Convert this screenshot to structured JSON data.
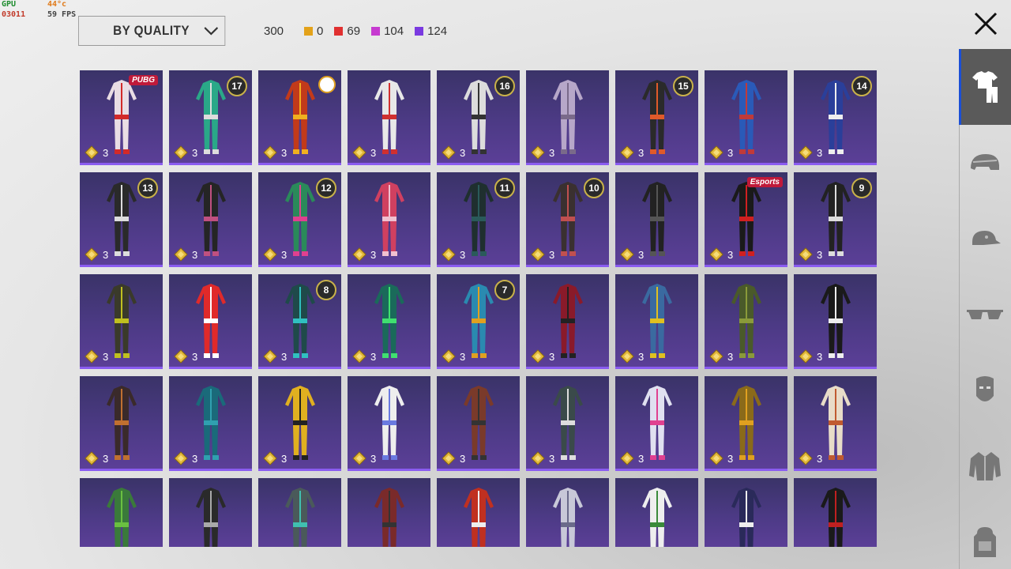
{
  "hud": {
    "gpu_label": "GPU",
    "gpu_value": "03011",
    "temp": "44°c",
    "fps": "59 FPS"
  },
  "sort": {
    "label": "BY QUALITY"
  },
  "stats": {
    "total": "300",
    "items": [
      {
        "value": "0",
        "color": "#e3a21a"
      },
      {
        "value": "69",
        "color": "#e03030"
      },
      {
        "value": "104",
        "color": "#c63ad0"
      },
      {
        "value": "124",
        "color": "#7a3ae0"
      }
    ]
  },
  "rail": [
    "shirt-icon",
    "helmet-icon",
    "cap-icon",
    "glasses-icon",
    "mask-icon",
    "jacket-icon",
    "backpack-icon"
  ],
  "accent": "#1b4fd6",
  "items": [
    {
      "qty": "3",
      "badge": "",
      "tag": "PUBG",
      "color": "#e9dde4",
      "accent": "#d22a2a"
    },
    {
      "qty": "3",
      "badge": "17",
      "tag": "",
      "color": "#2aa888",
      "accent": "#ddd"
    },
    {
      "qty": "3",
      "badge": "",
      "tag": "",
      "crest": true,
      "color": "#c23a1a",
      "accent": "#f0b020"
    },
    {
      "qty": "3",
      "badge": "",
      "tag": "",
      "color": "#e8e8e8",
      "accent": "#d03030"
    },
    {
      "qty": "3",
      "badge": "16",
      "tag": "",
      "color": "#dcdcdc",
      "accent": "#333"
    },
    {
      "qty": "3",
      "badge": "",
      "tag": "",
      "color": "#b7a7c9",
      "accent": "#7a6a8a"
    },
    {
      "qty": "3",
      "badge": "15",
      "tag": "",
      "color": "#2a2a2a",
      "accent": "#e05a2a"
    },
    {
      "qty": "3",
      "badge": "",
      "tag": "",
      "color": "#2a5ab8",
      "accent": "#c03a3a"
    },
    {
      "qty": "3",
      "badge": "14",
      "tag": "",
      "color": "#2a3f9a",
      "accent": "#eee"
    },
    {
      "qty": "3",
      "badge": "13",
      "tag": "",
      "color": "#2a2a2a",
      "accent": "#ddd"
    },
    {
      "qty": "3",
      "badge": "",
      "tag": "",
      "color": "#252525",
      "accent": "#c05080"
    },
    {
      "qty": "3",
      "badge": "12",
      "tag": "",
      "color": "#2a8a5a",
      "accent": "#e04090"
    },
    {
      "qty": "3",
      "badge": "",
      "tag": "",
      "color": "#d04060",
      "accent": "#f0c0d0"
    },
    {
      "qty": "3",
      "badge": "11",
      "tag": "",
      "color": "#1f2f2f",
      "accent": "#2a5a5a"
    },
    {
      "qty": "3",
      "badge": "10",
      "tag": "",
      "color": "#3a3030",
      "accent": "#c05050"
    },
    {
      "qty": "3",
      "badge": "",
      "tag": "",
      "color": "#222",
      "accent": "#555"
    },
    {
      "qty": "3",
      "badge": "",
      "tag": "Esports",
      "color": "#1a1a1a",
      "accent": "#d02020"
    },
    {
      "qty": "3",
      "badge": "9",
      "tag": "",
      "color": "#222",
      "accent": "#ddd"
    },
    {
      "qty": "3",
      "badge": "",
      "tag": "",
      "color": "#3a3a2a",
      "accent": "#c0c020"
    },
    {
      "qty": "3",
      "badge": "",
      "tag": "",
      "color": "#e02a2a",
      "accent": "#fff"
    },
    {
      "qty": "3",
      "badge": "8",
      "tag": "",
      "color": "#1f4a4a",
      "accent": "#30c0c0"
    },
    {
      "qty": "3",
      "badge": "",
      "tag": "",
      "color": "#1a6a5a",
      "accent": "#40e070"
    },
    {
      "qty": "3",
      "badge": "7",
      "tag": "",
      "color": "#2a8ab0",
      "accent": "#e0a020"
    },
    {
      "qty": "3",
      "badge": "",
      "tag": "",
      "color": "#8a1a2a",
      "accent": "#222"
    },
    {
      "qty": "3",
      "badge": "",
      "tag": "",
      "color": "#3a6aa0",
      "accent": "#e0c020"
    },
    {
      "qty": "3",
      "badge": "",
      "tag": "",
      "color": "#4a5a2a",
      "accent": "#8a9a3a"
    },
    {
      "qty": "3",
      "badge": "",
      "tag": "",
      "color": "#1a1a1a",
      "accent": "#eee"
    },
    {
      "qty": "3",
      "badge": "",
      "tag": "",
      "color": "#3a2a2a",
      "accent": "#c07030"
    },
    {
      "qty": "3",
      "badge": "",
      "tag": "",
      "color": "#1a6a7a",
      "accent": "#30a0b0"
    },
    {
      "qty": "3",
      "badge": "",
      "tag": "",
      "color": "#e0b020",
      "accent": "#222"
    },
    {
      "qty": "3",
      "badge": "",
      "tag": "",
      "color": "#eeeeee",
      "accent": "#6a7ae0"
    },
    {
      "qty": "3",
      "badge": "",
      "tag": "",
      "color": "#7a3a2a",
      "accent": "#333"
    },
    {
      "qty": "3",
      "badge": "",
      "tag": "",
      "color": "#3a4a4a",
      "accent": "#ddd"
    },
    {
      "qty": "3",
      "badge": "",
      "tag": "",
      "color": "#e0e0f0",
      "accent": "#e04090"
    },
    {
      "qty": "3",
      "badge": "",
      "tag": "",
      "color": "#8a6a1a",
      "accent": "#e0a020"
    },
    {
      "qty": "3",
      "badge": "",
      "tag": "",
      "color": "#e8dcc8",
      "accent": "#c05a30"
    },
    {
      "qty": "",
      "badge": "",
      "tag": "",
      "color": "#3a7a3a",
      "accent": "#6ac040"
    },
    {
      "qty": "",
      "badge": "",
      "tag": "",
      "color": "#2a2a2a",
      "accent": "#aaa"
    },
    {
      "qty": "",
      "badge": "",
      "tag": "",
      "color": "#4a5a5a",
      "accent": "#40c0b0"
    },
    {
      "qty": "",
      "badge": "",
      "tag": "",
      "color": "#7a2a2a",
      "accent": "#333"
    },
    {
      "qty": "",
      "badge": "",
      "tag": "",
      "color": "#c03020",
      "accent": "#eee"
    },
    {
      "qty": "",
      "badge": "",
      "tag": "",
      "color": "#c8c8d8",
      "accent": "#6a6a8a"
    },
    {
      "qty": "",
      "badge": "",
      "tag": "",
      "color": "#eeeeee",
      "accent": "#3a8a3a"
    },
    {
      "qty": "",
      "badge": "",
      "tag": "",
      "color": "#2a2a5a",
      "accent": "#eee"
    },
    {
      "qty": "",
      "badge": "",
      "tag": "",
      "color": "#1a1a1a",
      "accent": "#c02020"
    }
  ]
}
